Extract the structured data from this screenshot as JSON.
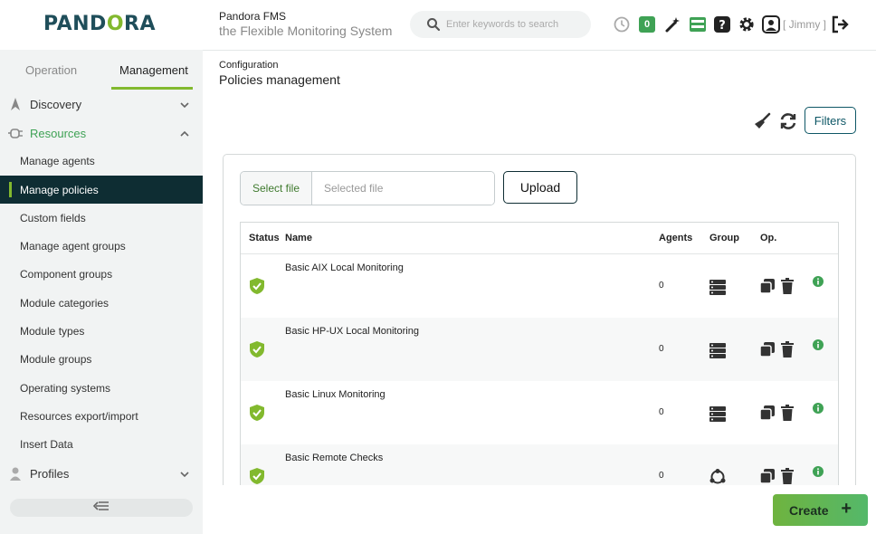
{
  "header": {
    "logo_text_left": "PAND",
    "logo_text_o": "O",
    "logo_text_right": "RA",
    "brand_title": "Pandora FMS",
    "brand_subtitle": "the Flexible Monitoring System",
    "search_placeholder": "Enter keywords to search",
    "notification_count": "0",
    "user_label": "[ Jimmy ]"
  },
  "sidebar": {
    "tabs": [
      {
        "label": "Operation",
        "active": false
      },
      {
        "label": "Management",
        "active": true
      }
    ],
    "sections": [
      {
        "label": "Discovery",
        "icon": "rocket-icon",
        "open": false
      },
      {
        "label": "Resources",
        "icon": "plug-icon",
        "open": true
      },
      {
        "label": "Profiles",
        "icon": "user-icon",
        "open": false
      }
    ],
    "resource_items": [
      {
        "label": "Manage agents"
      },
      {
        "label": "Manage policies",
        "active": true
      },
      {
        "label": "Custom fields"
      },
      {
        "label": "Manage agent groups"
      },
      {
        "label": "Component groups"
      },
      {
        "label": "Module categories"
      },
      {
        "label": "Module types"
      },
      {
        "label": "Module groups"
      },
      {
        "label": "Operating systems"
      },
      {
        "label": "Resources export/import"
      },
      {
        "label": "Insert Data"
      }
    ]
  },
  "main": {
    "breadcrumb": "Configuration",
    "title": "Policies management",
    "filters_label": "Filters",
    "select_file_label": "Select file",
    "file_placeholder": "Selected file",
    "upload_label": "Upload",
    "columns": [
      "Status",
      "Name",
      "Agents",
      "Group",
      "Op."
    ],
    "rows": [
      {
        "name": "Basic AIX Local Monitoring",
        "agents": "0",
        "group_icon": "server-icon"
      },
      {
        "name": "Basic HP-UX Local Monitoring",
        "agents": "0",
        "group_icon": "server-icon"
      },
      {
        "name": "Basic Linux Monitoring",
        "agents": "0",
        "group_icon": "server-icon"
      },
      {
        "name": "Basic Remote Checks",
        "agents": "0",
        "group_icon": "network-icon"
      }
    ],
    "create_label": "Create"
  },
  "colors": {
    "accent": "#82b92e",
    "dark": "#0e2d33",
    "status_ok": "#82b92e"
  }
}
